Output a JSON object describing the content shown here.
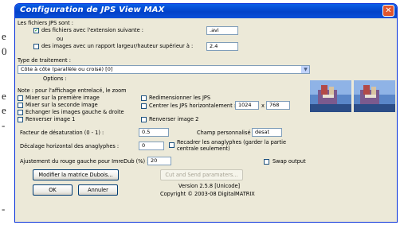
{
  "background_text": [
    "e",
    "0",
    "e",
    "e",
    "-",
    "-"
  ],
  "window": {
    "title": "Configuration de JPS View MAX"
  },
  "section_files": {
    "label": "Les fichiers JPS sont :",
    "ext_checkbox": {
      "label": "des fichiers avec l'extension suivante :",
      "checked": true,
      "value": ".avi"
    },
    "or_label": "ou",
    "ratio_checkbox": {
      "label": "des images avec un rapport largeur/hauteur supérieur à :",
      "checked": false,
      "value": "2.4"
    }
  },
  "processing": {
    "label": "Type de traitement :",
    "selected": "Côte à côte (parallèle ou croisé) [0]",
    "options_label": "Options :"
  },
  "note": "Note : pour l'affichage entrelacé, le zoom",
  "options_left": [
    {
      "label": "Mixer sur la première image",
      "checked": false
    },
    {
      "label": "Mixer sur la seconde image",
      "checked": false
    },
    {
      "label": "Echanger les images gauche & droite",
      "checked": false
    },
    {
      "label": "Renverser image 1",
      "checked": false
    }
  ],
  "options_right": [
    {
      "label": "Redimensionner les JPS",
      "checked": false
    },
    {
      "label": "Centrer les JPS horizontalement :",
      "checked": false
    }
  ],
  "center_size": {
    "width": "1024",
    "x_label": "x",
    "height": "768"
  },
  "flip2": {
    "label": "Renverser image 2",
    "checked": false
  },
  "desat": {
    "label": "Facteur de désaturation (0 - 1) :",
    "value": "0.5"
  },
  "custom_field": {
    "label": "Champ personnalisé :",
    "value": "desat"
  },
  "anaglyph_offset": {
    "label": "Décalage horizontal des anaglyphes :",
    "value": "0"
  },
  "crop_anaglyphs": {
    "label_line1": "Recadrer les anaglyphes (garder la partie",
    "label_line2": "centrale seulement)",
    "checked": false
  },
  "red_adjust": {
    "label": "Ajustement du rouge gauche pour ImreDub (%) :",
    "value": "20"
  },
  "swap_output": {
    "label": "Swap output",
    "checked": false
  },
  "buttons": {
    "dubois": "Modifier la matrice Dubois...",
    "cut_send": "Cut and Send paramaters...",
    "ok": "OK",
    "cancel": "Annuler"
  },
  "version": "Version 2.5.8 [Unicode]",
  "copyright": "Copyright © 2003-08 DigitalMATRIX"
}
